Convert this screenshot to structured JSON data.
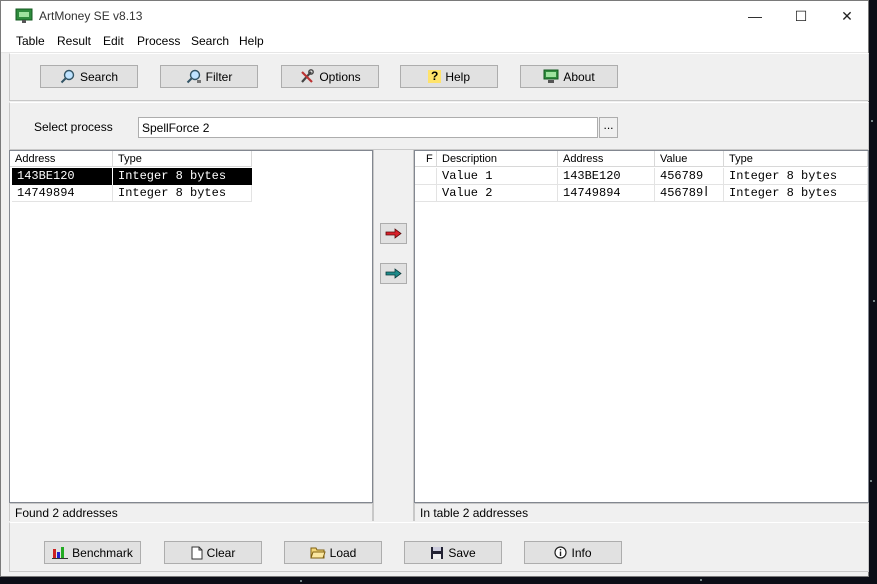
{
  "window": {
    "title": "ArtMoney SE v8.13",
    "minimize": "—",
    "maximize": "☐",
    "close": "✕"
  },
  "menu": [
    "Table",
    "Result",
    "Edit",
    "Process",
    "Search",
    "Help"
  ],
  "toolbar": {
    "search": "Search",
    "filter": "Filter",
    "options": "Options",
    "help": "Help",
    "about": "About"
  },
  "process": {
    "label": "Select process",
    "selected": "SpellForce 2",
    "browse": "..."
  },
  "left_table": {
    "headers": [
      "Address",
      "Type"
    ],
    "rows": [
      {
        "address": "143BE120",
        "type": "Integer 8 bytes"
      },
      {
        "address": "14749894",
        "type": "Integer 8 bytes"
      }
    ],
    "status": "Found 2 addresses"
  },
  "right_table": {
    "headers": [
      "F",
      "Description",
      "Address",
      "Value",
      "Type"
    ],
    "rows": [
      {
        "f": "",
        "description": "Value 1",
        "address": "143BE120",
        "value": "456789",
        "type": "Integer 8 bytes"
      },
      {
        "f": "",
        "description": "Value 2",
        "address": "14749894",
        "value": "456789",
        "type": "Integer 8 bytes"
      }
    ],
    "status": "In table 2 addresses"
  },
  "bottom": {
    "benchmark": "Benchmark",
    "clear": "Clear",
    "load": "Load",
    "save": "Save",
    "info": "Info"
  },
  "colors": {
    "add_arrow": "#d9202a",
    "add_all_arrow": "#1e8a8a",
    "selection": "#000000"
  }
}
